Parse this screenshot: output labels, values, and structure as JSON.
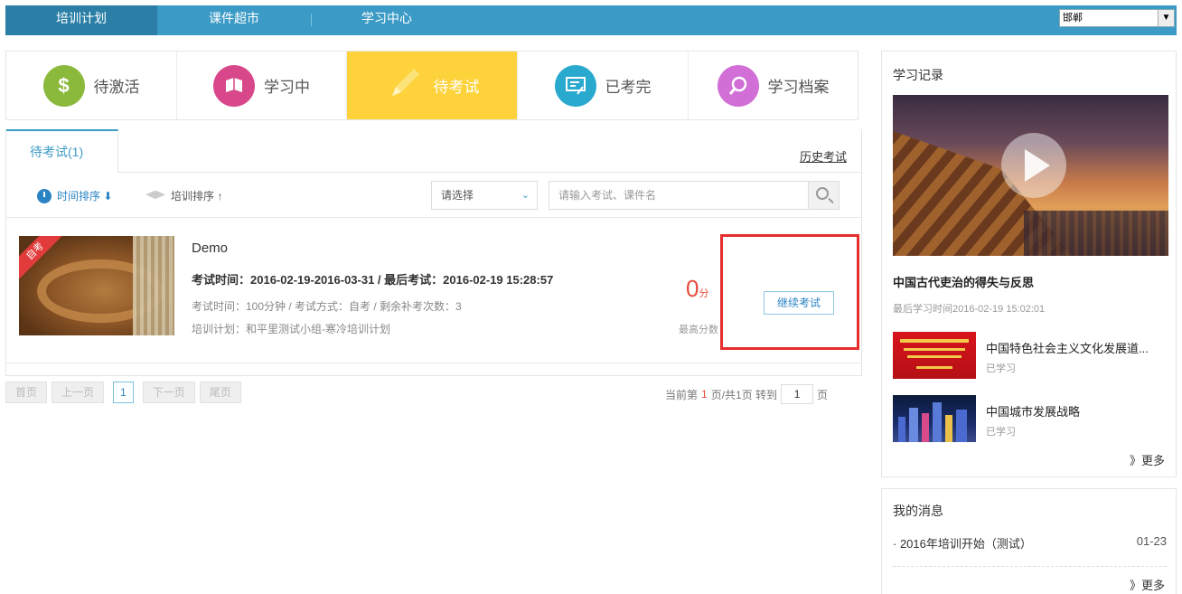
{
  "topnav": {
    "tabs": [
      "培训计划",
      "课件超市",
      "学习中心"
    ],
    "city_select": "邯郸",
    "colors": {
      "bar": "#3b9bc6",
      "active": "#2b7fa6"
    }
  },
  "status_tabs": [
    {
      "label": "待激活",
      "icon": "dollar-icon",
      "color": "#8bb93b"
    },
    {
      "label": "学习中",
      "icon": "book-icon",
      "color": "#d9478b"
    },
    {
      "label": "待考试",
      "icon": "pencil-icon",
      "color": "#fdd23a"
    },
    {
      "label": "已考完",
      "icon": "exam-report-icon",
      "color": "#2aa9cf"
    },
    {
      "label": "学习档案",
      "icon": "magnifier-icon",
      "color": "#d16fd6"
    }
  ],
  "main": {
    "subtab": "待考试(1)",
    "history_link": "历史考试",
    "sort_time": "时间排序 ⬇",
    "sort_plan": "培训排序 ↑",
    "select_placeholder": "请选择",
    "search_placeholder": "请输入考试、课件名",
    "exam": {
      "badge": "自考",
      "title": "Demo",
      "time_line": "考试时间：2016-02-19-2016-03-31  /   最后考试：2016-02-19 15:28:57",
      "meta_line": "考试时间：100分钟 / 考试方式：自考 / 剩余补考次数：3",
      "plan_line": "培训计划：和平里测试小组-寒冷培训计划",
      "score": "0",
      "score_unit": "分",
      "score_label": "最高分数",
      "continue_label": "继续考试"
    }
  },
  "pager": {
    "first": "首页",
    "prev": "上一页",
    "current": "1",
    "next": "下一页",
    "last": "尾页",
    "info_prefix": "当前第",
    "info_page": "1",
    "info_suffix": "页/共1页 转到",
    "goto_value": "1",
    "page_unit": "页"
  },
  "sidebar": {
    "title": "学习记录",
    "main_course": "中国古代吏治的得失与反思",
    "last_time": "最后学习时间2016-02-19 15:02:01",
    "records": [
      {
        "name": "中国特色社会主义文化发展道...",
        "status": "已学习"
      },
      {
        "name": "中国城市发展战略",
        "status": "已学习"
      }
    ],
    "more": "》更多"
  },
  "messages": {
    "title": "我的消息",
    "items": [
      {
        "text": "· 2016年培训开始（测试）",
        "date": "01-23"
      }
    ],
    "more": "》更多"
  }
}
